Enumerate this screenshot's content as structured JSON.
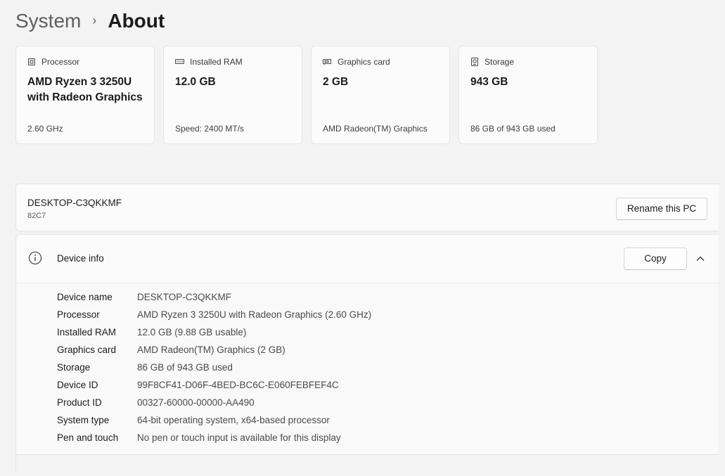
{
  "breadcrumb": {
    "parent": "System",
    "separator": "›",
    "current": "About"
  },
  "cards": [
    {
      "icon": "processor-icon",
      "label": "Processor",
      "value": "AMD Ryzen 3 3250U with Radeon Graphics",
      "sub": "2.60 GHz"
    },
    {
      "icon": "ram-icon",
      "label": "Installed RAM",
      "value": "12.0 GB",
      "sub": "Speed: 2400 MT/s"
    },
    {
      "icon": "graphics-card-icon",
      "label": "Graphics card",
      "value": "2 GB",
      "sub": "AMD Radeon(TM) Graphics"
    },
    {
      "icon": "storage-icon",
      "label": "Storage",
      "value": "943 GB",
      "sub": "86 GB of 943 GB used"
    }
  ],
  "pc": {
    "name": "DESKTOP-C3QKKMF",
    "model": "82C7",
    "rename_label": "Rename this PC"
  },
  "device_info": {
    "title": "Device info",
    "copy_label": "Copy",
    "specs": [
      {
        "label": "Device name",
        "value": "DESKTOP-C3QKKMF"
      },
      {
        "label": "Processor",
        "value": "AMD Ryzen 3 3250U with Radeon Graphics (2.60 GHz)"
      },
      {
        "label": "Installed RAM",
        "value": "12.0 GB (9.88 GB usable)"
      },
      {
        "label": "Graphics card",
        "value": "AMD Radeon(TM) Graphics (2 GB)"
      },
      {
        "label": "Storage",
        "value": "86 GB of 943 GB used"
      },
      {
        "label": "Device ID",
        "value": "99F8CF41-D06F-4BED-BC6C-E060FEBFEF4C"
      },
      {
        "label": "Product ID",
        "value": "00327-60000-00000-AA490"
      },
      {
        "label": "System type",
        "value": "64-bit operating system, x64-based processor"
      },
      {
        "label": "Pen and touch",
        "value": "No pen or touch input is available for this display"
      }
    ]
  },
  "colors": {
    "background": "#f3f3f3",
    "card": "#fbfbfb",
    "border": "#e5e5e5",
    "text": "#1b1b1b",
    "secondary_text": "#4a4a4a"
  }
}
